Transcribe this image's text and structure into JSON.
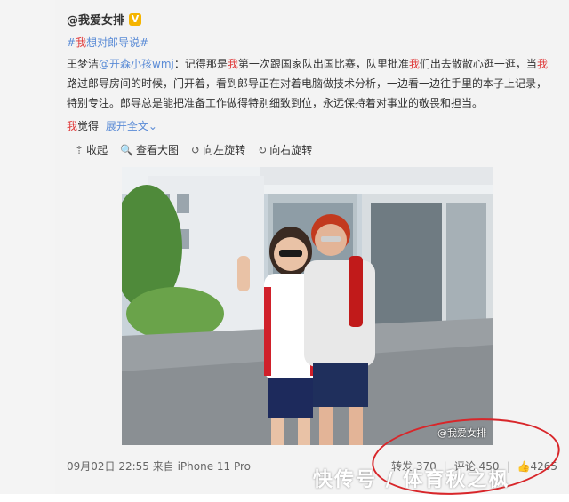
{
  "post": {
    "author": "@我爱女排",
    "badge": "V",
    "topic_prefix": "#",
    "topic_hl": "我",
    "topic_rest": "想对郎导说#",
    "body_1": "王梦洁",
    "body_mention": "@开森小孩wmj",
    "body_2": "：记得那是",
    "body_hl1": "我",
    "body_3": "第一次跟国家队出国比赛，队里批准",
    "body_hl2": "我",
    "body_4": "们出去散散心逛一逛，当",
    "body_hl3": "我",
    "body_5": "路过郎导房间的时候，门开着，看到郎导正在对着电脑做技术分析，一边看一边往手里的本子上记录，特别专注。郎导总是能把准备工作做得特别细致到位，永远保持着对事业的敬畏和担当。",
    "feel_hl": "我",
    "feel_text": "觉得",
    "expand": "展开全文",
    "expand_icon": "⌄"
  },
  "toolbar": {
    "collapse": "收起",
    "view_large": "查看大图",
    "rotate_left": "向左旋转",
    "rotate_right": "向右旋转",
    "collapse_icon": "⇡",
    "view_icon": "🔍",
    "left_icon": "↺",
    "right_icon": "↻"
  },
  "photo": {
    "watermark": "@我爱女排"
  },
  "footer": {
    "time_source": "09月02日 22:55 来自 iPhone 11 Pro",
    "repost": "转发 370",
    "comment": "评论 450",
    "like": "4265",
    "like_icon": "👍"
  },
  "overlay": {
    "watermark": "快传号 / 体育秋之枫",
    "circle_color": "#d8262a"
  }
}
